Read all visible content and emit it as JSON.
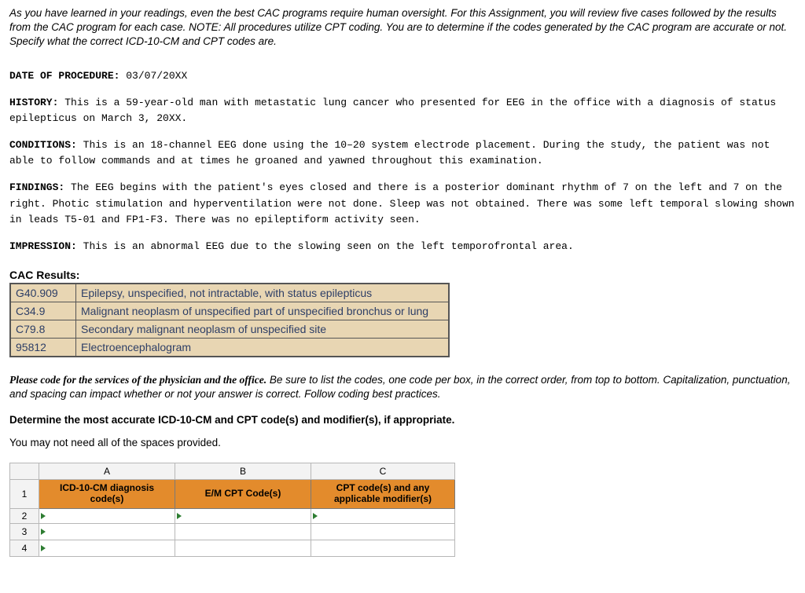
{
  "intro": "As you have learned in your readings, even the best CAC programs require human oversight. For this Assignment, you will review five cases followed by the results from the CAC program for each case. NOTE: All procedures utilize CPT coding. You are to determine if the codes generated by the CAC program are accurate or not. Specify what the correct ICD-10-CM and CPT codes are.",
  "report": {
    "date_label": "DATE OF PROCEDURE:",
    "date_value": "03/07/20XX",
    "history_label": "HISTORY:",
    "history_text": "This is a 59-year-old man with metastatic lung cancer who presented for EEG in the office with a diagnosis of status epilepticus on March 3, 20XX.",
    "conditions_label": "CONDITIONS:",
    "conditions_text": "This is an 18-channel EEG done using the 10–20 system electrode placement. During the study, the patient was not able to follow commands and at times he groaned and yawned throughout this examination.",
    "findings_label": "FINDINGS:",
    "findings_text": "The EEG begins with the patient's eyes closed and there is a posterior dominant rhythm of 7 on the left and 7 on the right. Photic stimulation and hyperventilation were not done. Sleep was not obtained. There was some left temporal slowing shown in leads T5-01 and FP1-F3. There was no epileptiform activity seen.",
    "impression_label": "IMPRESSION:",
    "impression_text": "This is an abnormal EEG due to the slowing seen on the left temporofrontal area."
  },
  "cac_heading": "CAC Results:",
  "cac_rows": [
    {
      "code": "G40.909",
      "desc": "Epilepsy, unspecified, not intractable, with status epilepticus"
    },
    {
      "code": "C34.9",
      "desc": "Malignant neoplasm of unspecified part of unspecified bronchus or lung"
    },
    {
      "code": "C79.8",
      "desc": "Secondary malignant neoplasm of unspecified site"
    },
    {
      "code": "95812",
      "desc": "Electroencephalogram"
    }
  ],
  "instructions": {
    "lead": "Please code for the services of the physician and the office.",
    "rest": " Be sure to list the codes, one code per box, in the correct order, from top to bottom. Capitalization, punctuation, and spacing can impact whether or not your answer is correct. Follow coding best practices.",
    "determine": "Determine the most accurate ICD-10-CM and CPT code(s) and modifier(s), if appropriate.",
    "note": "You may not need all of the spaces provided."
  },
  "sheet": {
    "col_letters": [
      "A",
      "B",
      "C"
    ],
    "row_numbers": [
      "1",
      "2",
      "3",
      "4"
    ],
    "headers": {
      "a": "ICD-10-CM diagnosis code(s)",
      "b": "E/M CPT Code(s)",
      "c": "CPT code(s) and any applicable modifier(s)"
    }
  }
}
